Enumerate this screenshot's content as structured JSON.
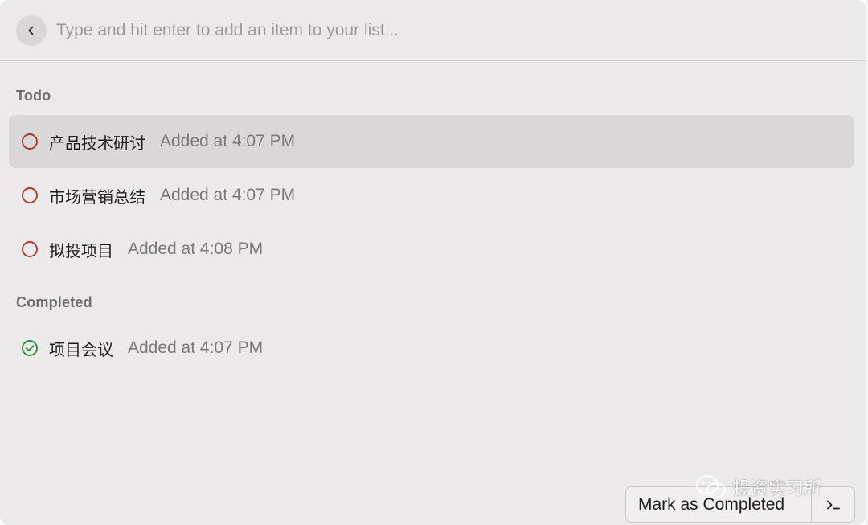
{
  "search": {
    "placeholder": "Type and hit enter to add an item to your list..."
  },
  "sections": {
    "todo_title": "Todo",
    "completed_title": "Completed"
  },
  "todo_items": [
    {
      "title": "产品技术研讨",
      "subtitle": "Added at 4:07 PM",
      "status": "todo",
      "selected": true
    },
    {
      "title": "市场营销总结",
      "subtitle": "Added at 4:07 PM",
      "status": "todo",
      "selected": false
    },
    {
      "title": "拟投项目",
      "subtitle": "Added at 4:08 PM",
      "status": "todo",
      "selected": false
    }
  ],
  "completed_items": [
    {
      "title": "项目会议",
      "subtitle": "Added at 4:07 PM",
      "status": "completed",
      "selected": false
    }
  ],
  "action_bar": {
    "primary_label": "Mark as Completed",
    "menu_icon": "terminal-prompt-icon"
  },
  "watermark": {
    "text": "投资实习所",
    "icon": "wechat-icon"
  },
  "colors": {
    "todo_circle": "#b2362b",
    "completed_check": "#2f8a3c",
    "background": "#ebe9ea",
    "selected_row": "#d9d7d8"
  }
}
